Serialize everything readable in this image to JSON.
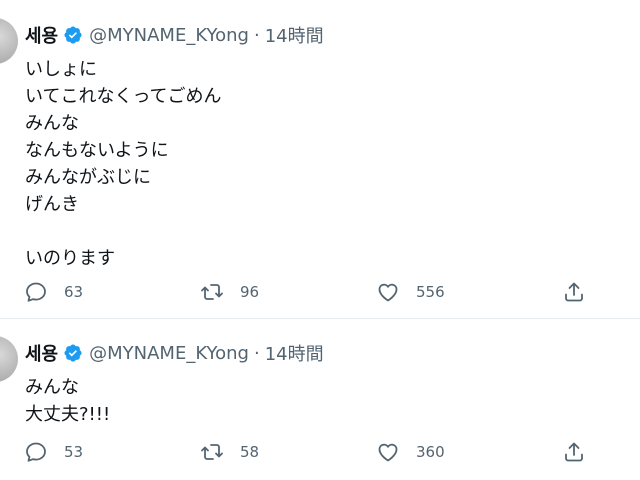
{
  "tweets": [
    {
      "display_name": "세용",
      "handle": "@MYNAME_KYong",
      "separator": "·",
      "time": "14時間",
      "lines": [
        "いしょに",
        "いてこれなくってごめん",
        "みんな",
        "なんもないように",
        "みんながぶじに",
        "げんき",
        "",
        "いのります"
      ],
      "replies": "63",
      "retweets": "96",
      "likes": "556"
    },
    {
      "display_name": "세용",
      "handle": "@MYNAME_KYong",
      "separator": "·",
      "time": "14時間",
      "lines": [
        "みんな",
        "大丈夫?!!!"
      ],
      "replies": "53",
      "retweets": "58",
      "likes": "360"
    }
  ],
  "colors": {
    "verified": "#1d9bf0",
    "muted_text": "#536471",
    "main_text": "#0f1419",
    "divider": "#e6ecf0"
  },
  "icons": [
    "verified-badge-icon",
    "reply-icon",
    "retweet-icon",
    "like-icon",
    "share-icon"
  ]
}
